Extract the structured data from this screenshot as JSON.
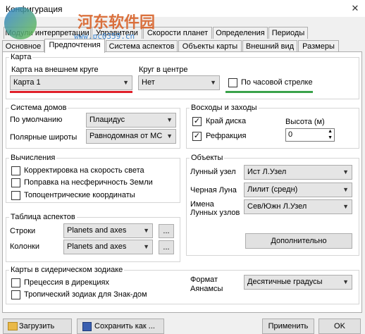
{
  "window": {
    "title": "Конфигурация",
    "close_glyph": "✕"
  },
  "watermark": {
    "title": "河东软件园",
    "url": "www.pc0359.cn"
  },
  "tabs_row1": [
    "Модули интерпретации",
    "Управители",
    "Скорости планет",
    "Определения",
    "Периоды"
  ],
  "tabs_row2": [
    "Основное",
    "Предпочтения",
    "Система аспектов",
    "Объекты карты",
    "Внешний вид",
    "Размеры"
  ],
  "karta": {
    "legend": "Карта",
    "outer_label": "Карта на внешнем круге",
    "outer_value": "Карта 1",
    "center_label": "Круг в центре",
    "center_value": "Нет",
    "clockwise_label": "По часовой стрелке",
    "clockwise_checked": false
  },
  "houses": {
    "legend": "Система домов",
    "default_label": "По умолчанию",
    "default_value": "Плацидус",
    "polar_label": "Полярные широты",
    "polar_value": "Равнодомная от МС"
  },
  "rise": {
    "legend": "Восходы и заходы",
    "disk_label": "Край диска",
    "disk_checked": true,
    "refr_label": "Рефракция",
    "refr_checked": true,
    "height_label": "Высота (м)",
    "height_value": "0"
  },
  "calc": {
    "legend": "Вычисления",
    "items": [
      "Корректировка на скорость света",
      "Поправка на несферичность Земли",
      "Топоцентрические координаты"
    ]
  },
  "objects": {
    "legend": "Объекты",
    "lunar_label": "Лунный узел",
    "lunar_value": "Ист Л.Узел",
    "black_label": "Черная Луна",
    "black_value": "Лилит (средн)",
    "names_label1": "Имена",
    "names_label2": "Лунных узлов",
    "names_value": "Сев/Южн Л.Узел",
    "extra_button": "Дополнительно"
  },
  "aspects": {
    "legend": "Таблица аспектов",
    "rows_label": "Строки",
    "rows_value": "Planets and axes",
    "cols_label": "Колонки",
    "cols_value": "Planets and axes",
    "ellipsis": "..."
  },
  "sidereal": {
    "legend": "Карты в сидерическом зодиаке",
    "items": [
      "Прецессия в дирекциях",
      "Тропический зодиак для Знак-дом"
    ],
    "format_label1": "Формат",
    "format_label2": "Аянамсы",
    "format_value": "Десятичные градусы"
  },
  "footer": {
    "load": "Загрузить",
    "save_as": "Сохранить как ...",
    "apply": "Применить",
    "ok": "OK"
  }
}
